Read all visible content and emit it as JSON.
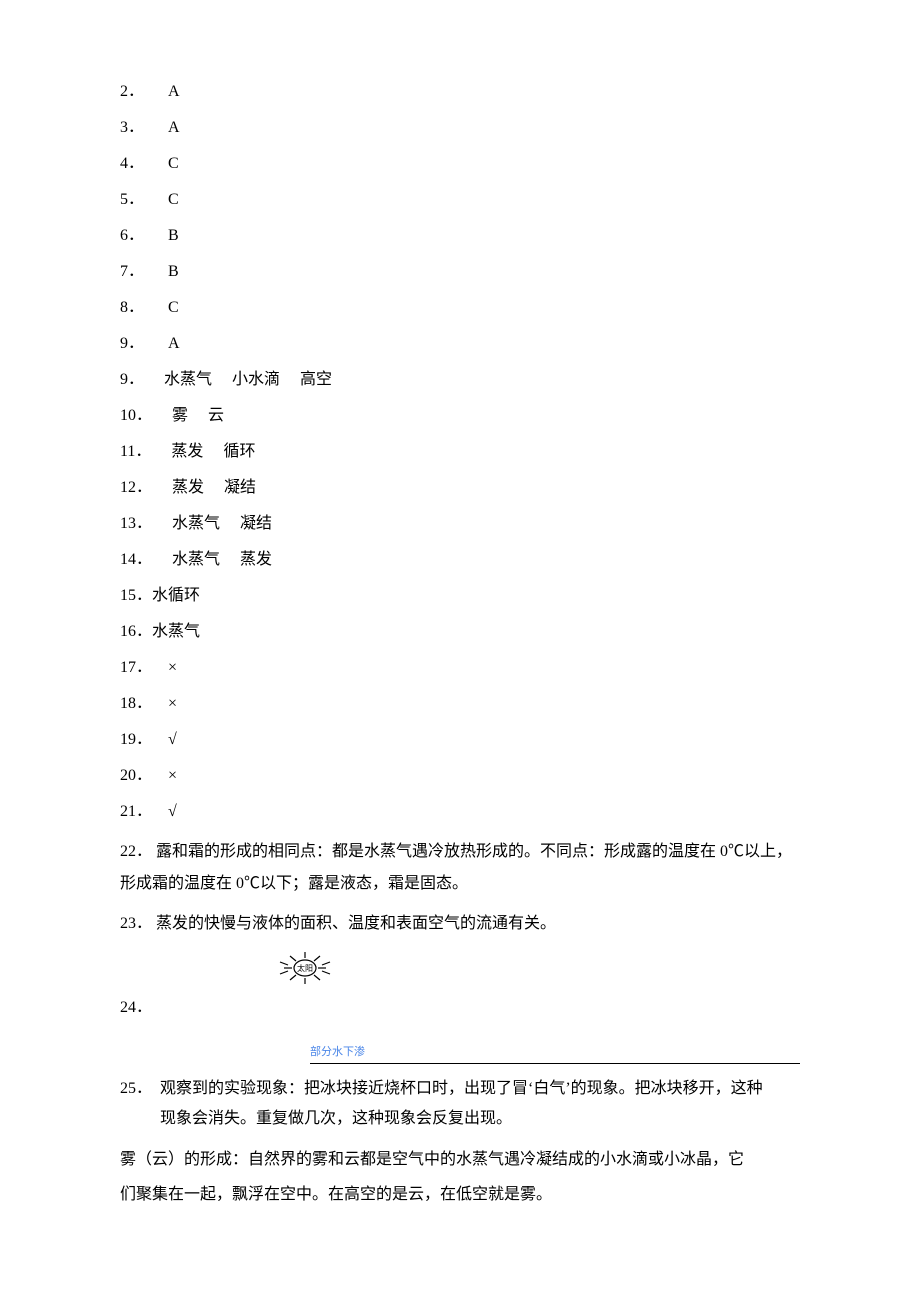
{
  "answers_mc": [
    {
      "n": "2",
      "v": "A"
    },
    {
      "n": "3",
      "v": "A"
    },
    {
      "n": "4",
      "v": "C"
    },
    {
      "n": "5",
      "v": "C"
    },
    {
      "n": "6",
      "v": "B"
    },
    {
      "n": "7",
      "v": "B"
    },
    {
      "n": "8",
      "v": "C"
    },
    {
      "n": "9",
      "v": "A"
    }
  ],
  "answers_fill": [
    {
      "n": "9",
      "blanks": [
        "水蒸气",
        "小水滴",
        "高空"
      ]
    },
    {
      "n": "10",
      "blanks": [
        "雾",
        "云"
      ]
    },
    {
      "n": "11",
      "blanks": [
        "蒸发",
        "循环"
      ]
    },
    {
      "n": "12",
      "blanks": [
        "蒸发",
        "凝结"
      ]
    },
    {
      "n": "13",
      "blanks": [
        "水蒸气",
        "凝结"
      ]
    },
    {
      "n": "14",
      "blanks": [
        "水蒸气",
        "蒸发"
      ]
    }
  ],
  "answers_short": [
    {
      "n": "15",
      "v": "水循环"
    },
    {
      "n": "16",
      "v": "水蒸气"
    }
  ],
  "answers_tf": [
    {
      "n": "17",
      "v": "×"
    },
    {
      "n": "18",
      "v": "×"
    },
    {
      "n": "19",
      "v": "√"
    },
    {
      "n": "20",
      "v": "×"
    },
    {
      "n": "21",
      "v": "√"
    }
  ],
  "q22": {
    "n": "22",
    "text": "露和霜的形成的相同点：都是水蒸气遇冷放热形成的。不同点：形成露的温度在 0℃以上，形成霜的温度在 0℃以下；露是液态，霜是固态。"
  },
  "q23": {
    "n": "23",
    "text": "蒸发的快慢与液体的面积、温度和表面空气的流通有关。"
  },
  "sun_label": "太阳",
  "q24": {
    "n": "24"
  },
  "blue_caption": "部分水下渗",
  "q25": {
    "n": "25",
    "line1": "观察到的实验现象：把冰块接近烧杯口时，出现了冒‘白气’的现象。把冰块移开，这种",
    "line2": "现象会消失。重复做几次，这种现象会反复出现。"
  },
  "fog_para1": "雾（云）的形成：自然界的雾和云都是空气中的水蒸气遇冷凝结成的小水滴或小冰晶，它",
  "fog_para2": "们聚集在一起，飘浮在空中。在高空的是云，在低空就是雾。"
}
